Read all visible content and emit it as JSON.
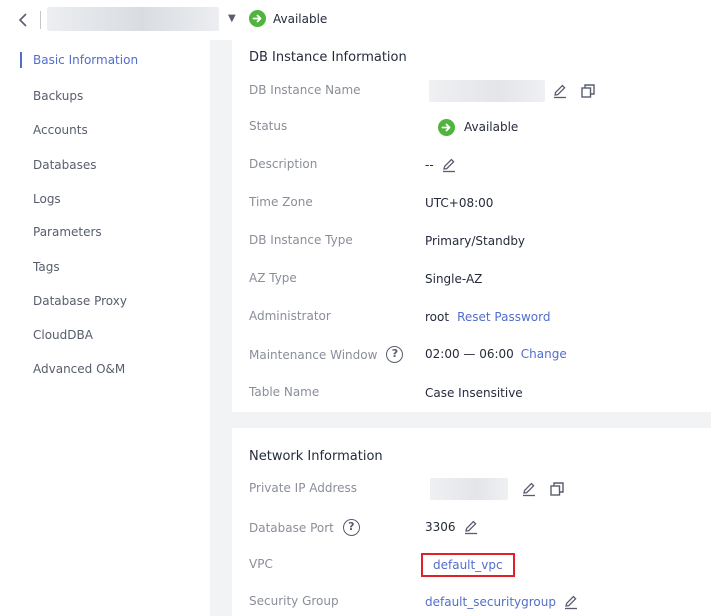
{
  "header": {
    "back_icon": "chevron-left-icon",
    "status_label": "Available"
  },
  "sidebar": {
    "items": [
      {
        "label": "Basic Information",
        "active": true
      },
      {
        "label": "Backups"
      },
      {
        "label": "Accounts"
      },
      {
        "label": "Databases"
      },
      {
        "label": "Logs"
      },
      {
        "label": "Parameters"
      },
      {
        "label": "Tags"
      },
      {
        "label": "Database Proxy"
      },
      {
        "label": "CloudDBA"
      },
      {
        "label": "Advanced O&M"
      }
    ]
  },
  "db_info": {
    "title": "DB Instance Information",
    "name_label": "DB Instance Name",
    "status_label": "Status",
    "status_value": "Available",
    "description_label": "Description",
    "description_value": "--",
    "timezone_label": "Time Zone",
    "timezone_value": "UTC+08:00",
    "type_label": "DB Instance Type",
    "type_value": "Primary/Standby",
    "az_label": "AZ Type",
    "az_value": "Single-AZ",
    "admin_label": "Administrator",
    "admin_value": "root",
    "reset_password": "Reset Password",
    "maint_label": "Maintenance Window",
    "maint_value": "02:00 — 06:00",
    "change": "Change",
    "table_name_label": "Table Name",
    "table_name_value": "Case Insensitive"
  },
  "network_info": {
    "title": "Network Information",
    "private_ip_label": "Private IP Address",
    "port_label": "Database Port",
    "port_value": "3306",
    "vpc_label": "VPC",
    "vpc_value": "default_vpc",
    "sg_label": "Security Group",
    "sg_value": "default_securitygroup"
  },
  "colors": {
    "accent": "#526ecc",
    "status_green": "#50b43f",
    "highlight_red": "#e0202a"
  }
}
